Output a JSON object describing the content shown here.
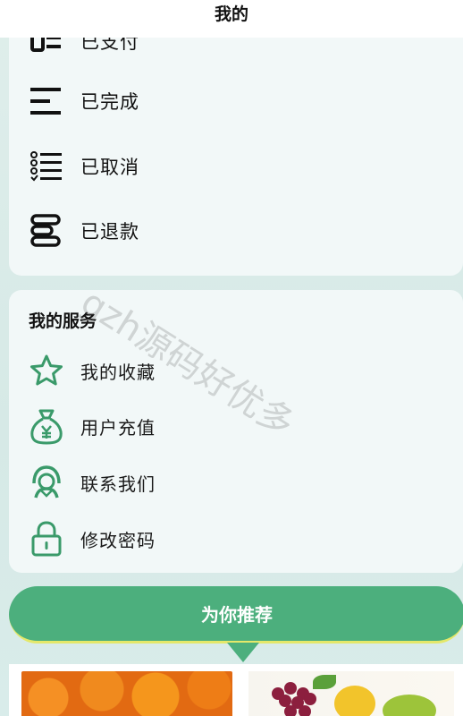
{
  "header": {
    "title": "我的"
  },
  "orders": {
    "items": [
      {
        "label": "已支付",
        "icon": "payment-icon"
      },
      {
        "label": "已完成",
        "icon": "completed-icon"
      },
      {
        "label": "已取消",
        "icon": "cancelled-icon"
      },
      {
        "label": "已退款",
        "icon": "refund-icon"
      }
    ]
  },
  "services": {
    "title": "我的服务",
    "items": [
      {
        "label": "我的收藏",
        "icon": "star-icon"
      },
      {
        "label": "用户充值",
        "icon": "money-bag-icon"
      },
      {
        "label": "联系我们",
        "icon": "customer-service-icon"
      },
      {
        "label": "修改密码",
        "icon": "lock-icon"
      }
    ]
  },
  "recommend": {
    "label": "为你推荐"
  },
  "watermark": {
    "text": "gzh源码好优多"
  },
  "colors": {
    "accent": "#4caf7d",
    "card": "#f2f8f8",
    "icon_green": "#3a9a6a"
  }
}
